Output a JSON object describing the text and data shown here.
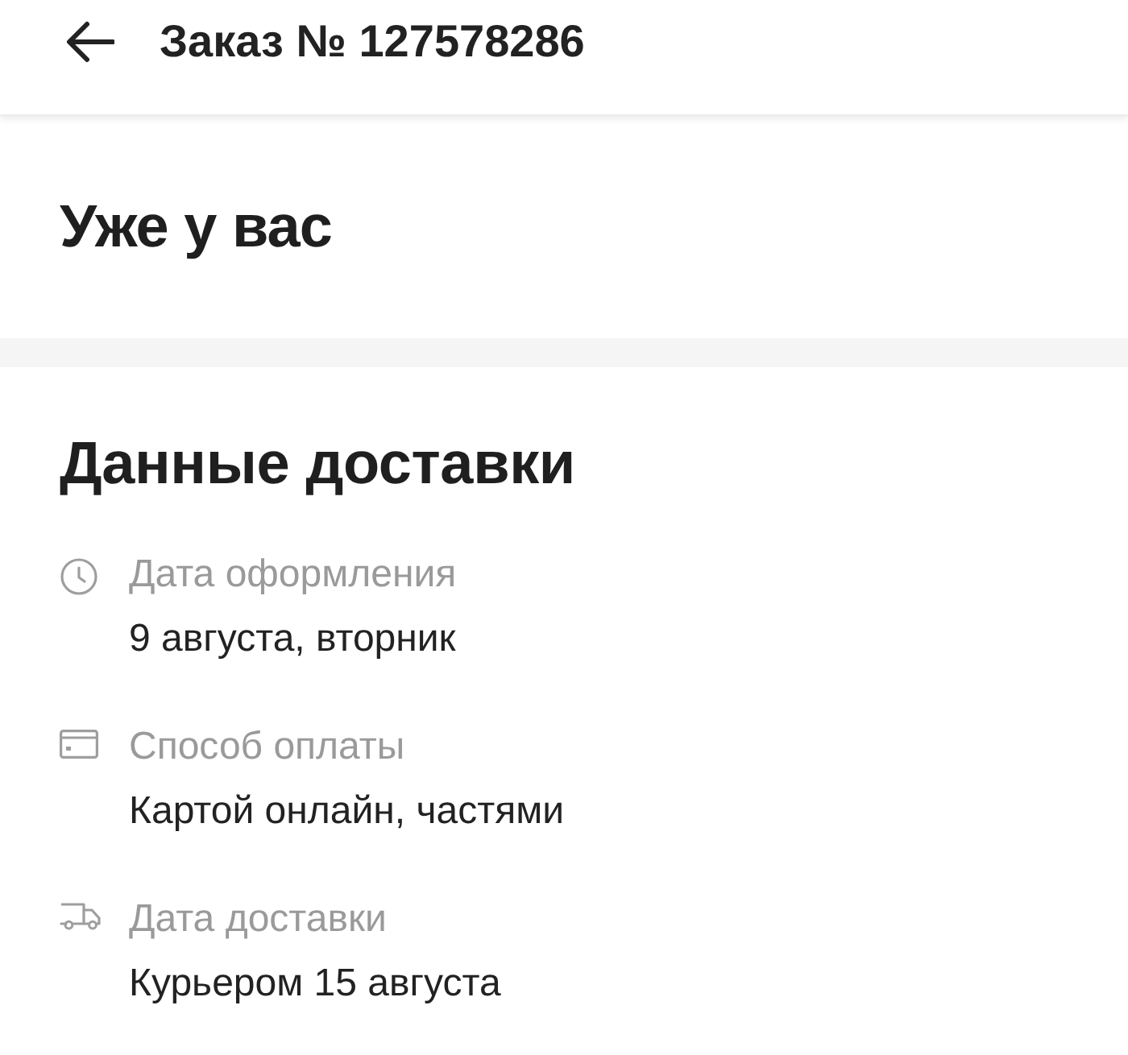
{
  "header": {
    "title": "Заказ № 127578286"
  },
  "status": {
    "title": "Уже у вас"
  },
  "delivery": {
    "title": "Данные доставки",
    "items": [
      {
        "kind": "clock",
        "label": "Дата оформления",
        "value": "9 августа, вторник"
      },
      {
        "kind": "card",
        "label": "Способ оплаты",
        "value": "Картой онлайн, частями"
      },
      {
        "kind": "truck",
        "label": "Дата доставки",
        "value": "Курьером 15 августа"
      }
    ]
  }
}
